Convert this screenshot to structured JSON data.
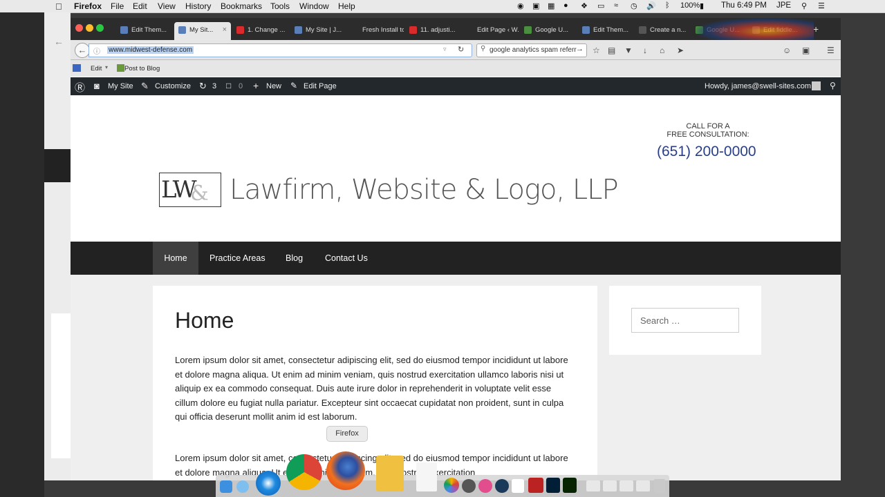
{
  "menubar": {
    "app": "Firefox",
    "items": [
      "File",
      "Edit",
      "View",
      "History",
      "Bookmarks",
      "Tools",
      "Window",
      "Help"
    ],
    "battery": "100%",
    "clock": "Thu 6:49 PM",
    "user": "JPE"
  },
  "tabs": [
    {
      "label": "Edit Them...",
      "color": "#5a7fb8"
    },
    {
      "label": "My Sit...",
      "color": "#5a7fb8"
    },
    {
      "label": "1. Change ...",
      "color": "#d92b2b"
    },
    {
      "label": "My Site | J...",
      "color": "#5a7fb8"
    },
    {
      "label": "Fresh Install to...",
      "color": "#2c2c2c"
    },
    {
      "label": "11. adjusti...",
      "color": "#d92b2b"
    },
    {
      "label": "Edit Page ‹ W...",
      "color": "#2c2c2c"
    },
    {
      "label": "Google U...",
      "color": "#4a8f3f"
    },
    {
      "label": "Edit Them...",
      "color": "#5a7fb8"
    },
    {
      "label": "Create a n...",
      "color": "#555"
    },
    {
      "label": "Google U...",
      "color": "#4a8f3f"
    },
    {
      "label": "Edit fiddle...",
      "color": "#777"
    }
  ],
  "nav": {
    "url": "www.midwest-defense.com",
    "search_value": "google analytics spam referr"
  },
  "bookmarks": {
    "edit": "Edit",
    "post_to_blog": "Post to Blog"
  },
  "wpbar": {
    "my_site": "My Site",
    "customize": "Customize",
    "updates": "3",
    "comments": "0",
    "new": "New",
    "edit_page": "Edit Page",
    "howdy": "Howdy, james@swell-sites.com"
  },
  "site": {
    "logo_text": "LW",
    "logo_amp": "&",
    "name": "Lawfirm, Website & Logo, LLP",
    "call_line1": "CALL FOR A",
    "call_line2": "FREE CONSULTATION:",
    "phone": "(651) 200-0000",
    "menu": [
      "Home",
      "Practice Areas",
      "Blog",
      "Contact Us"
    ],
    "page_title": "Home",
    "para1": "Lorem ipsum dolor sit amet, consectetur adipiscing elit, sed do eiusmod tempor incididunt ut labore et dolore magna aliqua. Ut enim ad minim veniam, quis nostrud exercitation ullamco laboris nisi ut aliquip ex ea commodo consequat. Duis aute irure dolor in reprehenderit in voluptate velit esse cillum dolore eu fugiat nulla pariatur. Excepteur sint occaecat cupidatat non proident, sunt in culpa qui officia deserunt mollit anim id est laborum.",
    "para2": "Lorem ipsum dolor sit amet, consectetur adipiscing elit, sed do eiusmod tempor incididunt ut labore et dolore magna aliqua. Ut enim ad minim veniam, quis nostrud exercitation",
    "search_placeholder": "Search …"
  },
  "dock": {
    "tooltip": "Firefox"
  }
}
